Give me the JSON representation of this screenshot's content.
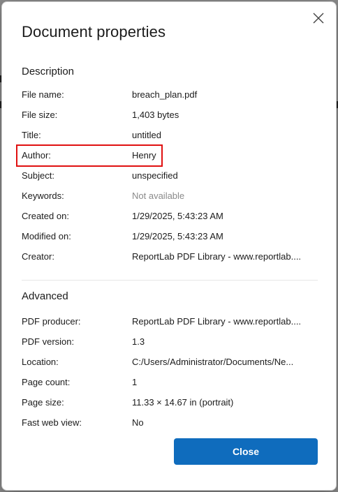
{
  "dialog": {
    "title": "Document properties",
    "close_icon": "close-icon",
    "close_button_label": "Close",
    "accent": "#0f6cbd",
    "highlight_color": "#e01010"
  },
  "description": {
    "heading": "Description",
    "rows": [
      {
        "label": "File name:",
        "value": "breach_plan.pdf"
      },
      {
        "label": "File size:",
        "value": "1,403 bytes"
      },
      {
        "label": "Title:",
        "value": "untitled"
      },
      {
        "label": "Author:",
        "value": "Henry"
      },
      {
        "label": "Subject:",
        "value": "unspecified"
      },
      {
        "label": "Keywords:",
        "value": "Not available"
      },
      {
        "label": "Created on:",
        "value": "1/29/2025, 5:43:23 AM"
      },
      {
        "label": "Modified on:",
        "value": "1/29/2025, 5:43:23 AM"
      },
      {
        "label": "Creator:",
        "value": "ReportLab PDF Library - www.reportlab...."
      }
    ]
  },
  "advanced": {
    "heading": "Advanced",
    "rows": [
      {
        "label": "PDF producer:",
        "value": "ReportLab PDF Library - www.reportlab...."
      },
      {
        "label": "PDF version:",
        "value": "1.3"
      },
      {
        "label": "Location:",
        "value": "C:/Users/Administrator/Documents/Ne..."
      },
      {
        "label": "Page count:",
        "value": "1"
      },
      {
        "label": "Page size:",
        "value": "11.33 × 14.67 in (portrait)"
      },
      {
        "label": "Fast web view:",
        "value": "No"
      }
    ]
  }
}
